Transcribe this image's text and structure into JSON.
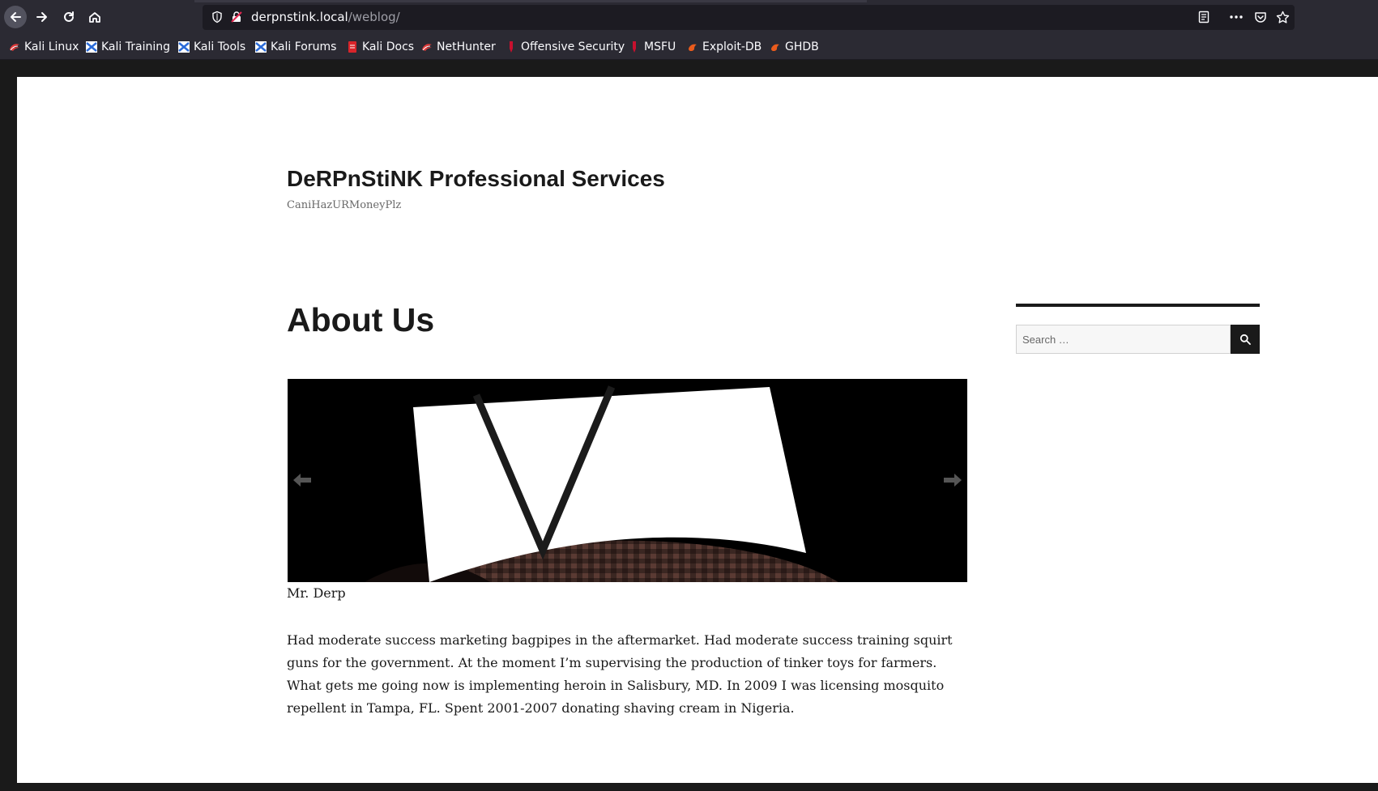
{
  "browser": {
    "url_host": "derpnstink.local",
    "url_path": "/weblog/",
    "bookmarks": [
      {
        "label": "Kali Linux",
        "icon": "kali-dragon-icon"
      },
      {
        "label": "Kali Training",
        "icon": "kali-training-icon"
      },
      {
        "label": "Kali Tools",
        "icon": "kali-tools-icon"
      },
      {
        "label": "Kali Forums",
        "icon": "kali-forums-icon"
      },
      {
        "label": "Kali Docs",
        "icon": "kali-docs-icon"
      },
      {
        "label": "NetHunter",
        "icon": "nethunter-icon"
      },
      {
        "label": "Offensive Security",
        "icon": "offsec-icon"
      },
      {
        "label": "MSFU",
        "icon": "msfu-icon"
      },
      {
        "label": "Exploit-DB",
        "icon": "exploitdb-icon"
      },
      {
        "label": "GHDB",
        "icon": "ghdb-icon"
      }
    ]
  },
  "site": {
    "title": "DeRPnStiNK Professional Services",
    "tagline": "CaniHazURMoneyPlz"
  },
  "post": {
    "title": "About Us",
    "image_caption": "Mr. Derp",
    "body": "Had moderate success marketing bagpipes in the aftermarket. Had moderate success training squirt guns for the government. At the moment I’m supervising the production of tinker toys for farmers. What gets me going now is implementing heroin in Salisbury, MD. In 2009 I was licensing mosquito repellent in Tampa, FL. Spent 2001-2007 donating shaving cream in Nigeria."
  },
  "sidebar": {
    "search_placeholder": "Search …"
  },
  "colors": {
    "chrome": "#2b2a33",
    "chrome_dark": "#1c1b22",
    "text": "#1a1a1a",
    "accent_kali": "#e03b3b"
  }
}
